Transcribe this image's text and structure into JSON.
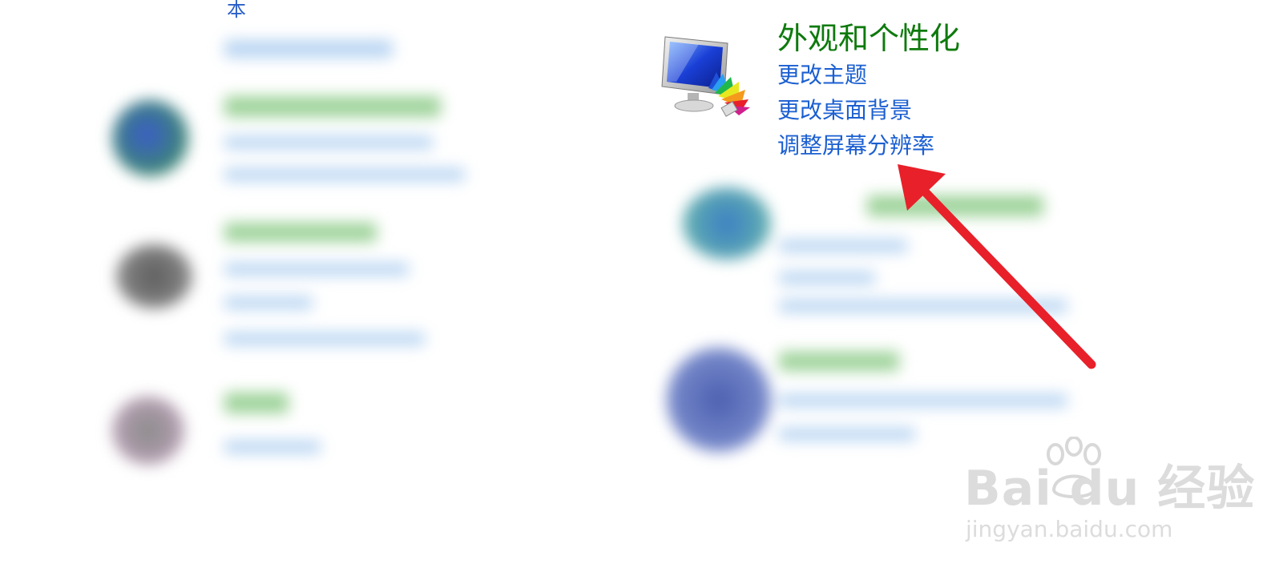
{
  "top_partial_char": "本",
  "appearance": {
    "title": "外观和个性化",
    "links": [
      "更改主题",
      "更改桌面背景",
      "调整屏幕分辨率"
    ]
  },
  "watermark": {
    "brand": "Bai du 经验",
    "site": "jingyan.baidu.com"
  },
  "colors": {
    "title_green": "#0e7a0d",
    "link_blue": "#1b5fd1",
    "arrow_red": "#e8202a"
  }
}
